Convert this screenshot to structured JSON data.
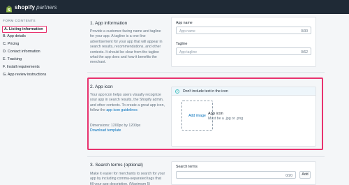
{
  "brand": {
    "name": "shopify",
    "suffix": "partners"
  },
  "sidebar": {
    "heading": "FORM CONTENTS",
    "items": [
      {
        "label": "A. Listing information"
      },
      {
        "label": "B. App details"
      },
      {
        "label": "C. Pricing"
      },
      {
        "label": "D. Contact information"
      },
      {
        "label": "E. Tracking"
      },
      {
        "label": "F. Install requirements"
      },
      {
        "label": "G. App review instructions"
      }
    ]
  },
  "app_information": {
    "title": "1. App information",
    "description": "Provide a customer-facing name and tagline for your app. A tagline is a one-line advertisement for your app that will appear in search results, recommendations, and other contexts. It should be clear from the tagline what the app does and how it benefits the merchant.",
    "app_name": {
      "label": "App name",
      "placeholder": "App name",
      "count": "0/30"
    },
    "tagline": {
      "label": "Tagline",
      "placeholder": "App tagline",
      "count": "0/62"
    }
  },
  "app_icon": {
    "title": "2. App icon",
    "description": "Your app icon helps users visually recognize your app in search results, the Shopify admin, and other contexts. To create a great app icon, follow the",
    "guidelines_link": "app icon guidelines",
    "dimensions": "Dimensions: 1200px by 1200px",
    "download_link": "Download template",
    "banner": "Don't include text in the icon",
    "add_image": "Add image",
    "icon_label": "App icon",
    "icon_help": "Must be a .jpg or .png"
  },
  "search_terms": {
    "title": "3. Search terms (optional)",
    "description": "Make it easier for merchants to search for your app by including comma-separated tags that fill your app description. (Maximum 5)",
    "label": "Search terms",
    "count": "0/20",
    "add_label": "Add"
  }
}
